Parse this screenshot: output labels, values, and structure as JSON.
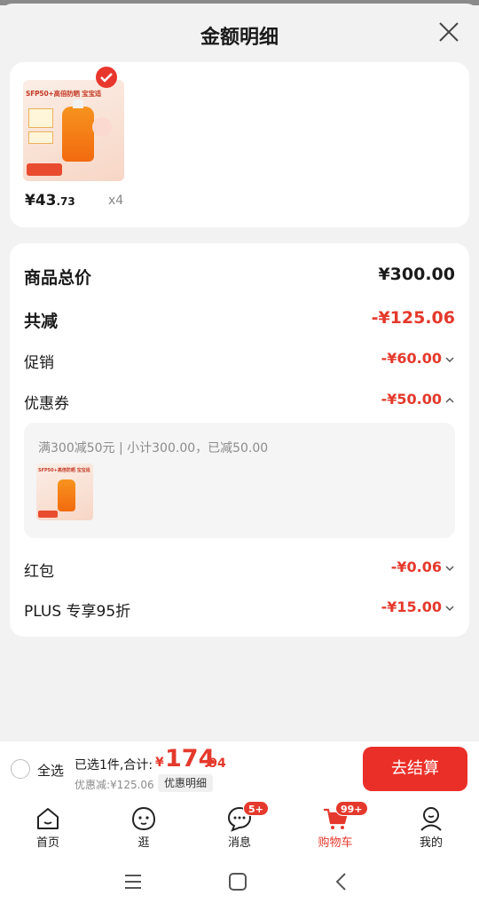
{
  "sheet": {
    "title": "金额明细"
  },
  "product": {
    "image_caption": "SFP50+高倍防晒 宝宝适",
    "price_int": "¥43",
    "price_dec": ".73",
    "qty": "x4"
  },
  "details": {
    "total_label": "商品总价",
    "total_value": "¥300.00",
    "reduce_label": "共减",
    "reduce_value": "-¥125.06",
    "promo_label": "促销",
    "promo_value": "-¥60.00",
    "coupon_label": "优惠券",
    "coupon_value": "-¥50.00",
    "coupon_desc": "满300减50元 | 小计300.00，已减50.00",
    "hongbao_label": "红包",
    "hongbao_value": "-¥0.06",
    "plus_label": "PLUS 专享95折",
    "plus_value": "-¥15.00"
  },
  "checkout": {
    "select_all": "全选",
    "summary": "已选1件,合计:",
    "total_yen": "¥",
    "total_int": "174",
    "total_dec": ".94",
    "discount_note": "优惠减:¥125.06",
    "detail_button": "优惠明细",
    "checkout_button": "去结算"
  },
  "tabs": [
    {
      "label": "首页",
      "icon": "home-icon"
    },
    {
      "label": "逛",
      "icon": "explore-face-icon"
    },
    {
      "label": "消息",
      "icon": "message-icon",
      "badge": "5+"
    },
    {
      "label": "购物车",
      "icon": "cart-icon",
      "badge": "99+",
      "active": true
    },
    {
      "label": "我的",
      "icon": "profile-icon"
    }
  ],
  "colors": {
    "accent": "#e4392c",
    "button": "#ea2f28"
  }
}
